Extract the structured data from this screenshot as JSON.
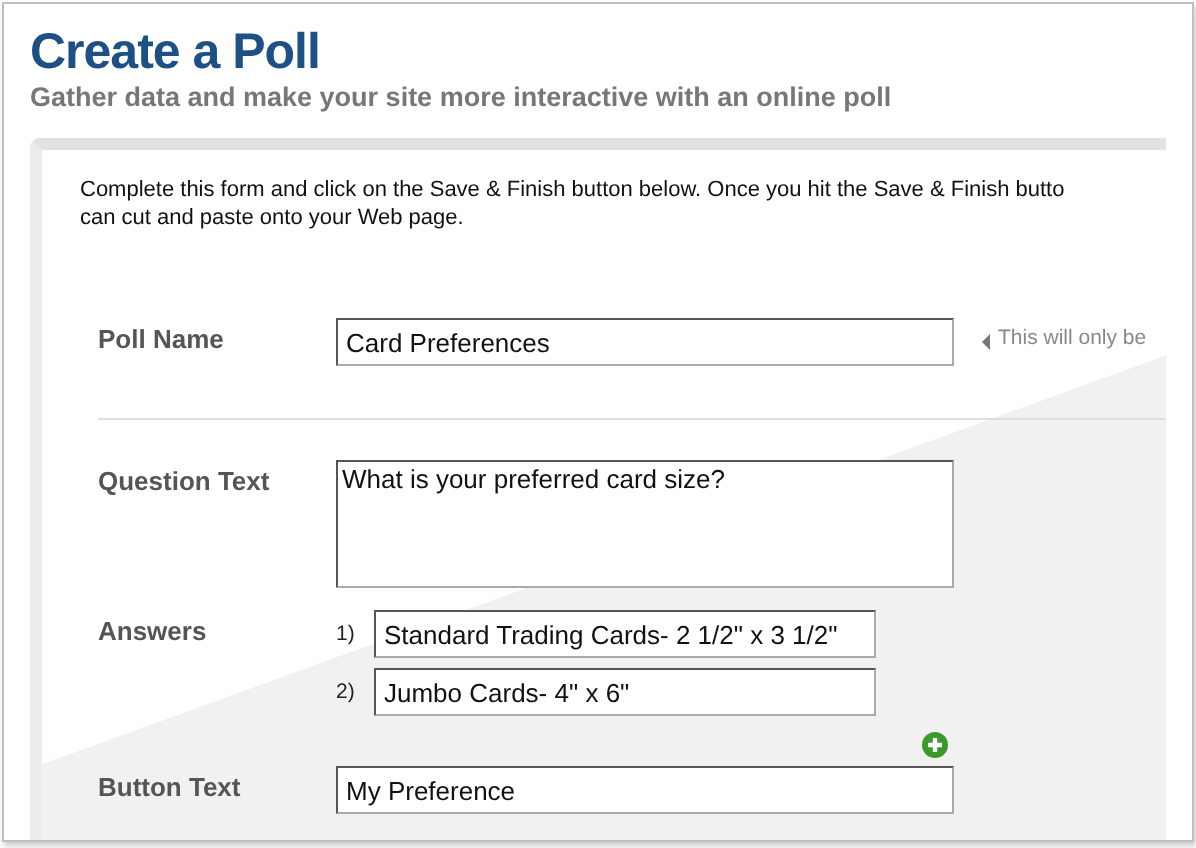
{
  "title": "Create a Poll",
  "subtitle": "Gather data and make your site more interactive with an online poll",
  "intro": [
    "Complete this form and click on the Save & Finish button below. Once you hit the Save & Finish butto",
    "can cut and paste onto your Web page."
  ],
  "poll_name": {
    "label": "Poll Name",
    "value": "Card Preferences",
    "hint": "This will only be"
  },
  "question": {
    "label": "Question Text",
    "value": "What is your preferred card size?"
  },
  "answers": {
    "label": "Answers",
    "items": [
      {
        "number": "1)",
        "value": "Standard Trading Cards- 2 1/2\" x 3 1/2\""
      },
      {
        "number": "2)",
        "value": "Jumbo Cards- 4\" x 6\""
      }
    ]
  },
  "button_text": {
    "label": "Button Text",
    "value": "My Preference"
  }
}
